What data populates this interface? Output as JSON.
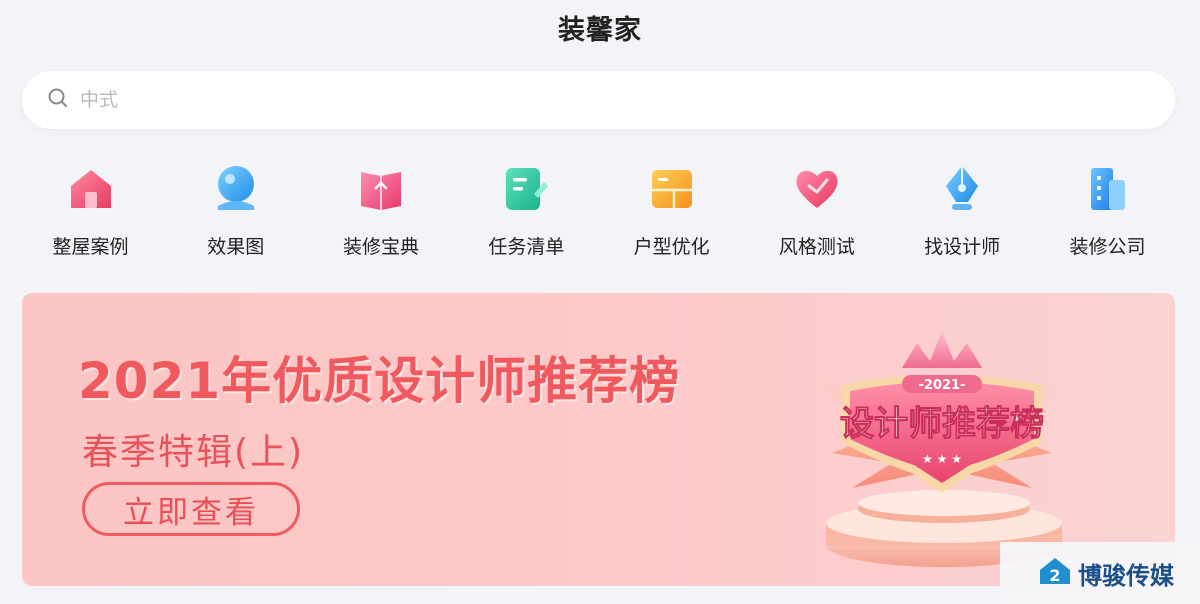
{
  "header": {
    "title": "装馨家"
  },
  "search": {
    "placeholder": "中式"
  },
  "nav": [
    {
      "label": "整屋案例",
      "icon": "house-icon",
      "color": "#f0566e"
    },
    {
      "label": "效果图",
      "icon": "globe-icon",
      "color": "#3aa2f0"
    },
    {
      "label": "装修宝典",
      "icon": "book-icon",
      "color": "#f25a80"
    },
    {
      "label": "任务清单",
      "icon": "checklist-icon",
      "color": "#2fc9a2"
    },
    {
      "label": "户型优化",
      "icon": "floorplan-icon",
      "color": "#f6a52a"
    },
    {
      "label": "风格测试",
      "icon": "heart-icon",
      "color": "#f2507a"
    },
    {
      "label": "找设计师",
      "icon": "pen-nib-icon",
      "color": "#2f9cf0"
    },
    {
      "label": "装修公司",
      "icon": "building-icon",
      "color": "#2f8ef0"
    }
  ],
  "banner": {
    "title": "2021年优质设计师推荐榜",
    "subtitle": "春季特辑(上)",
    "button_label": "立即查看",
    "badge_year": "-2021-",
    "badge_text": "设计师推荐榜"
  },
  "watermark": {
    "text": "博骏传媒"
  }
}
